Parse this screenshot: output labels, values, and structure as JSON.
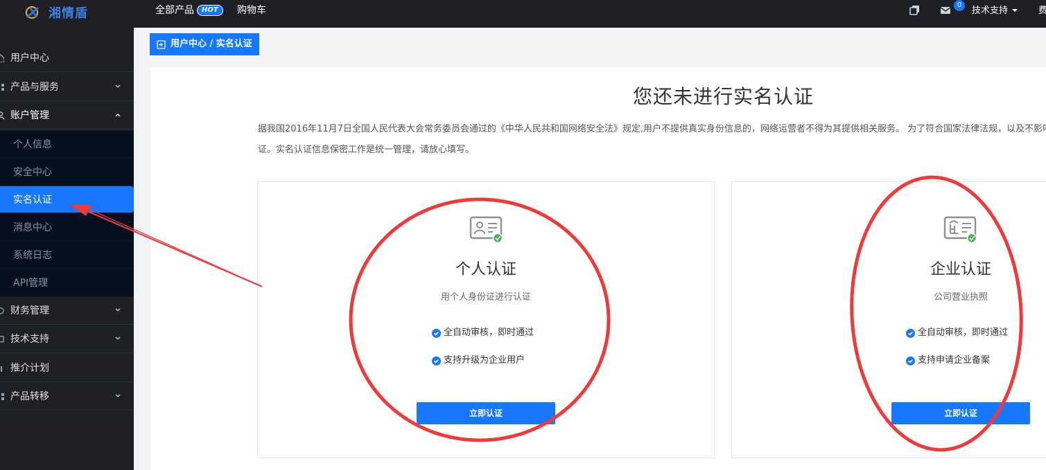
{
  "topbar": {
    "logo_text": "湘情盾",
    "nav": [
      {
        "label": "全部产品",
        "badge": "HOT"
      },
      {
        "label": "购物车"
      }
    ],
    "message_count": "0",
    "support_label": "技术支持",
    "cut_label": "费"
  },
  "sidebar": {
    "items": [
      {
        "label": "用户中心",
        "icon": "home-icon"
      },
      {
        "label": "产品与服务",
        "icon": "grid-icon",
        "chevron": "down"
      },
      {
        "label": "账户管理",
        "icon": "user-icon",
        "chevron": "up"
      },
      {
        "label": "财务管理",
        "icon": "wallet-icon",
        "chevron": "down"
      },
      {
        "label": "技术支持",
        "icon": "support-icon",
        "chevron": "down"
      },
      {
        "label": "推介计划",
        "icon": "chart-icon"
      },
      {
        "label": "产品转移",
        "icon": "transfer-icon",
        "chevron": "down"
      }
    ],
    "submenu": [
      {
        "label": "个人信息"
      },
      {
        "label": "安全中心"
      },
      {
        "label": "实名认证",
        "active": true
      },
      {
        "label": "消息中心"
      },
      {
        "label": "系统日志"
      },
      {
        "label": "API管理"
      }
    ]
  },
  "breadcrumb": "用户中心 / 实名认证",
  "main": {
    "title": "您还未进行实名认证",
    "intro_line1": "据我国2016年11月7日全国人民代表大会常务委员会通过的《中华人民共和国网络安全法》规定,用户不提供真实身份信息的，网络运营者不得为其提供相关服务。 为了符合国家法律法规，以及不影响",
    "intro_line2": "证。实名认证信息保密工作是统一管理，请放心填写。",
    "cards": [
      {
        "title": "个人认证",
        "subtitle": "用个人身份证进行认证",
        "features": [
          "全自动审核，即时通过",
          "支持升级为企业用户"
        ],
        "button": "立即认证",
        "icon": "id-card-icon"
      },
      {
        "title": "企业认证",
        "subtitle": "公司营业执照",
        "features": [
          "全自动审核，即时通过",
          "支持申请企业备案"
        ],
        "button": "立即认证",
        "icon": "business-license-icon"
      }
    ]
  },
  "colors": {
    "accent": "#1677ff",
    "sidebar_bg": "#1f2026",
    "submenu_bg": "#07101e",
    "annotation_red": "#f03a3a",
    "check_green": "#3fb950"
  }
}
